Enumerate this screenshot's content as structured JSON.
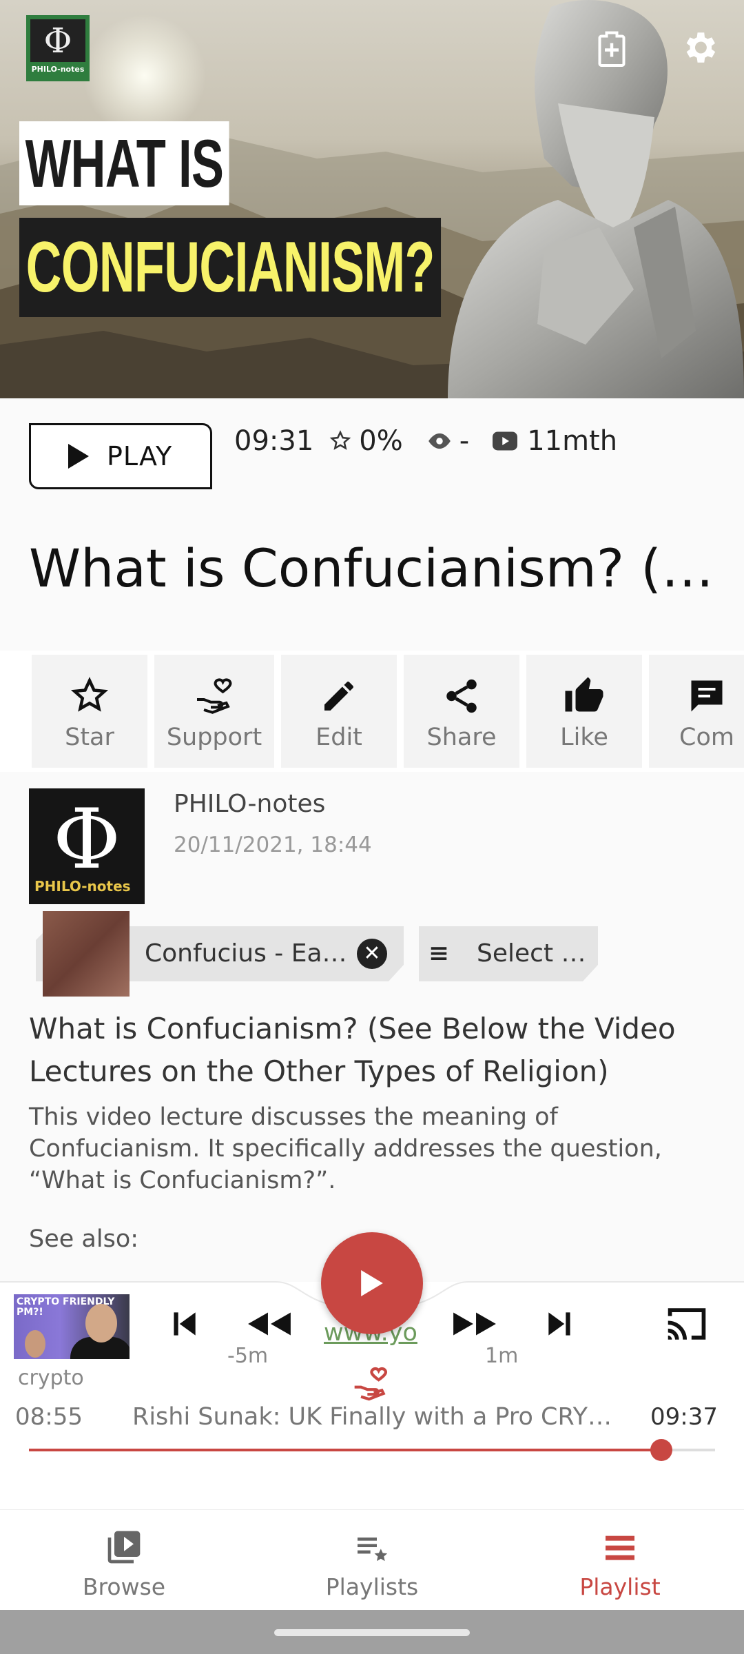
{
  "hero": {
    "logo_symbol": "Φ",
    "logo_label": "PHILO-notes",
    "title_line1": "WHAT IS",
    "title_line2": "CONFUCIANISM?",
    "icons": [
      "clipboard-add-icon",
      "gear-icon"
    ]
  },
  "stats": {
    "play_label": "PLAY",
    "duration": "09:31",
    "rating": "0%",
    "views": "-",
    "age": "11mth"
  },
  "video_title": "What is Confucianism? (…",
  "actions": [
    {
      "label": "Star",
      "icon": "star-icon"
    },
    {
      "label": "Support",
      "icon": "support-heart-icon"
    },
    {
      "label": "Edit",
      "icon": "pencil-icon"
    },
    {
      "label": "Share",
      "icon": "share-icon"
    },
    {
      "label": "Like",
      "icon": "thumbs-up-icon"
    },
    {
      "label": "Com",
      "icon": "comment-icon"
    }
  ],
  "channel": {
    "logo_symbol": "Φ",
    "logo_tag": "PHILO-notes",
    "name": "PHILO-notes",
    "date": "20/11/2021, 18:44"
  },
  "chips": {
    "playlist_chip": "Confucius - Ea…",
    "select_chip": "Select …"
  },
  "description": {
    "title": "What is Confucianism? (See Below the Video Lectures on the Other Types of Religion)",
    "body": "This video lecture discusses the meaning of Confucianism. It specifically addresses the question, “What is Confucianism?”.",
    "see_also": "See also:",
    "link_fragment": "www.yo"
  },
  "player": {
    "thumb_text": "CRYPTO FRIENDLY PM?!",
    "channel": "crypto",
    "rewind_label": "-5m",
    "forward_label": "1m",
    "elapsed": "08:55",
    "title": "Rishi Sunak: UK Finally with a Pro CRY…",
    "total": "09:37",
    "progress": 0.922,
    "accent": "#c84742"
  },
  "nav": [
    {
      "label": "Browse",
      "icon": "browse-icon",
      "active": false
    },
    {
      "label": "Playlists",
      "icon": "playlists-icon",
      "active": false
    },
    {
      "label": "Playlist",
      "icon": "playlist-icon",
      "active": true
    }
  ]
}
